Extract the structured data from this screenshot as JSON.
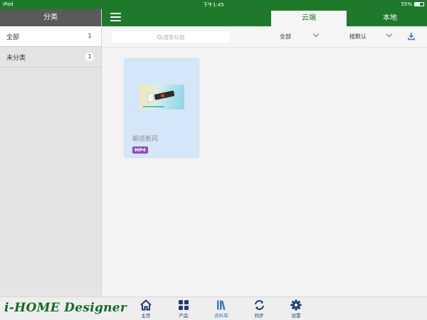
{
  "status_bar": {
    "device": "iPad",
    "time": "下午1:45",
    "battery": "55%",
    "battery_level": 0.55
  },
  "sidebar": {
    "header": "分类",
    "items": [
      {
        "label": "全部",
        "count": "1"
      },
      {
        "label": "未分类",
        "count": "1"
      }
    ]
  },
  "topbar": {
    "tabs": [
      {
        "label": "云端"
      },
      {
        "label": "本地"
      }
    ]
  },
  "filter": {
    "search_placeholder": "搜索标题",
    "category_value": "全部",
    "sort_value": "按默认"
  },
  "content": {
    "items": [
      {
        "title": "邮适新风",
        "type_badge": "MP4"
      }
    ]
  },
  "bottom_bar": {
    "logo": "i-HOME Designer",
    "nav": [
      {
        "label": "主页"
      },
      {
        "label": "产品"
      },
      {
        "label": "资料库"
      },
      {
        "label": "同步"
      },
      {
        "label": "设置"
      }
    ]
  },
  "colors": {
    "brand_green": "#1e7a2a",
    "accent_blue": "#3b7ac2",
    "nav_icon": "#1f3c6e",
    "badge_purple": "#8e4fb0"
  }
}
